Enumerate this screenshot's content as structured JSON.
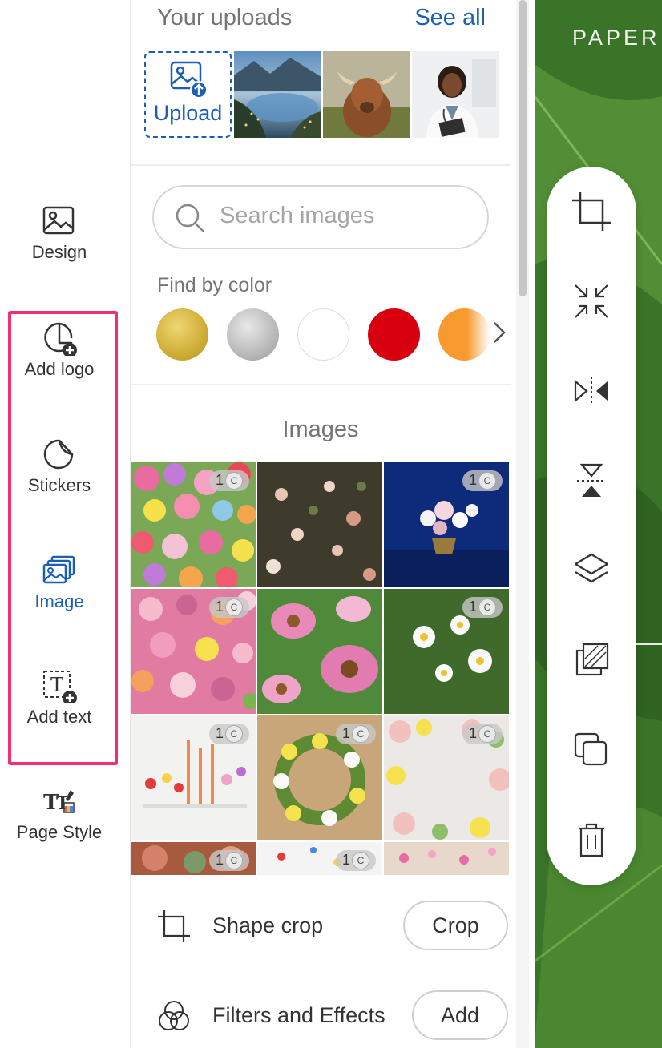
{
  "left_nav": {
    "items": [
      {
        "label": "Design",
        "icon": "image-icon"
      },
      {
        "label": "Add logo",
        "icon": "logo-add-icon"
      },
      {
        "label": "Stickers",
        "icon": "sticker-icon"
      },
      {
        "label": "Image",
        "icon": "images-stack-icon",
        "active": true
      },
      {
        "label": "Add text",
        "icon": "add-text-icon"
      },
      {
        "label": "Page Style",
        "icon": "page-style-icon"
      }
    ]
  },
  "uploads": {
    "title": "Your uploads",
    "see_all": "See all",
    "upload_label": "Upload",
    "thumbnails": [
      "coastal-town-photo",
      "highland-cow-photo",
      "doctor-photo"
    ]
  },
  "search": {
    "placeholder": "Search images"
  },
  "find_by_color": {
    "label": "Find by color",
    "swatches": [
      "gold",
      "silver",
      "white",
      "red",
      "orange"
    ]
  },
  "images": {
    "title": "Images",
    "badge_count": "1",
    "badge_coin": "C"
  },
  "actions": {
    "shape_crop": {
      "label": "Shape crop",
      "button": "Crop"
    },
    "filters": {
      "label": "Filters and Effects",
      "button": "Add"
    }
  },
  "canvas": {
    "text": "PAPER"
  },
  "toolbar": {
    "tools": [
      "crop-icon",
      "shrink-icon",
      "flip-horizontal-icon",
      "flip-vertical-icon",
      "layers-icon",
      "arrange-icon",
      "duplicate-icon",
      "delete-icon"
    ]
  },
  "colors": {
    "accent": "#1a5fb4",
    "highlight": "#f2306e",
    "gold": "#d6b93e",
    "silver": "#bdbdbd",
    "red": "#d8000f",
    "orange": "#f79a30"
  }
}
